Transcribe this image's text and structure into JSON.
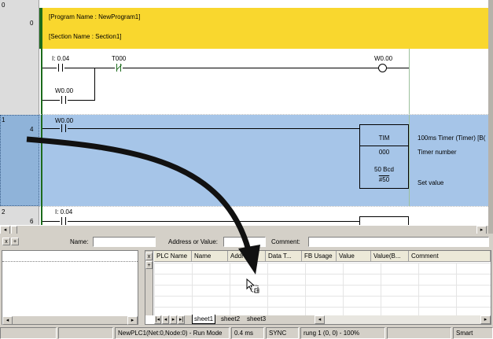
{
  "section_header": {
    "program_name": "[Program Name : NewProgram1]",
    "section_name": "[Section Name : Section1]"
  },
  "rungs": [
    {
      "index": "0",
      "step": "0"
    },
    {
      "index": "1",
      "step": "4"
    },
    {
      "index": "2",
      "step": "6"
    }
  ],
  "rung0": {
    "contact1": "I: 0.04",
    "contact2": "T000",
    "branch_contact": "W0.00",
    "output_coil": "W0.00"
  },
  "rung1": {
    "contact1": "W0.00",
    "instruction": "TIM",
    "timer_number_value": "000",
    "set_value_bcd": "50 Bcd",
    "set_value": "#50",
    "comment_instruction": "100ms Timer (Timer) [B(",
    "comment_timer_number": "Timer number",
    "comment_set_value": "Set value"
  },
  "rung2": {
    "contact1": "I: 0.04"
  },
  "watch_bar": {
    "name_label": "Name:",
    "address_label": "Address or Value:",
    "comment_label": "Comment:"
  },
  "watch_grid": {
    "columns": [
      "PLC Name",
      "Name",
      "Address",
      "Data T...",
      "FB Usage",
      "Value",
      "Value(B...",
      "Comment"
    ],
    "tabs": [
      "sheet1",
      "sheet2",
      "sheet3"
    ]
  },
  "status_bar": {
    "plc": "NewPLC1(Net:0,Node:0) - Run Mode",
    "cycle": "0.4 ms",
    "sync": "SYNC",
    "rung": "rung 1 (0, 0)  - 100%",
    "mode": "Smart"
  },
  "colors": {
    "header_yellow": "#f9d72e",
    "selected_rung": "#a6c5e8",
    "rail_green": "#1c6b1c"
  }
}
